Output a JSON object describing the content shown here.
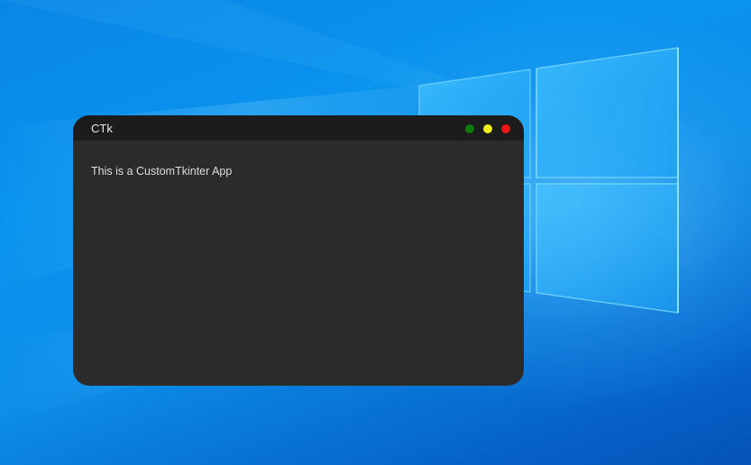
{
  "window": {
    "title": "CTk",
    "background": "#2b2b2b",
    "titlebar_background": "#1c1c1c",
    "buttons": [
      {
        "name": "green",
        "color": "#0d7a0d"
      },
      {
        "name": "yellow",
        "color": "#f2ef1a"
      },
      {
        "name": "red",
        "color": "#f01414"
      }
    ]
  },
  "content": {
    "label": "This is a CustomTkinter App"
  },
  "desktop": {
    "wallpaper": "windows-10-logo",
    "accent": "#0a86e6"
  }
}
